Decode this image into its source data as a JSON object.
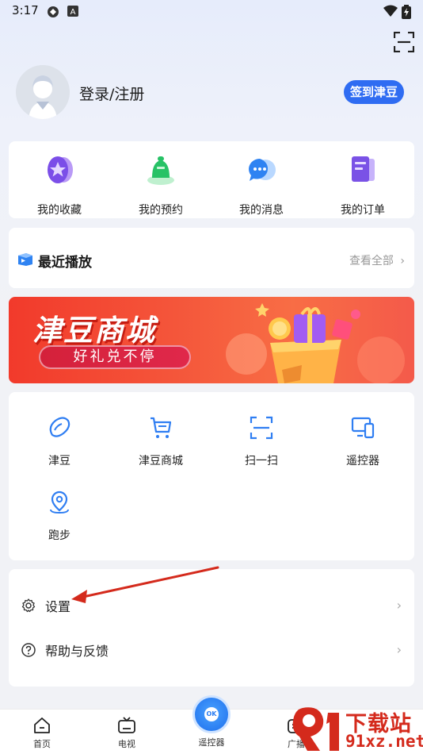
{
  "status_bar": {
    "time": "3:17"
  },
  "profile": {
    "login_label": "登录/注册",
    "checkin_label": "签到津豆"
  },
  "quick_links": [
    {
      "label": "我的收藏",
      "icon": "favorites-icon"
    },
    {
      "label": "我的预约",
      "icon": "reservation-bell-icon"
    },
    {
      "label": "我的消息",
      "icon": "message-bubble-icon"
    },
    {
      "label": "我的订单",
      "icon": "order-icon"
    }
  ],
  "recent": {
    "title": "最近播放",
    "more": "查看全部"
  },
  "banner": {
    "title": "津豆商城",
    "slogan": "好礼兑不停"
  },
  "tools": [
    {
      "label": "津豆",
      "icon": "bean-icon"
    },
    {
      "label": "津豆商城",
      "icon": "cart-icon"
    },
    {
      "label": "扫一扫",
      "icon": "scan-icon"
    },
    {
      "label": "遥控器",
      "icon": "devices-icon"
    },
    {
      "label": "跑步",
      "icon": "location-pin-icon"
    }
  ],
  "settings": [
    {
      "label": "设置",
      "icon": "gear-icon"
    },
    {
      "label": "帮助与反馈",
      "icon": "help-icon"
    }
  ],
  "bottom_nav": [
    {
      "label": "首页",
      "icon": "home-icon"
    },
    {
      "label": "电视",
      "icon": "tv-icon"
    },
    {
      "label": "遥控器",
      "icon": "remote-icon"
    },
    {
      "label": "广播",
      "icon": "radio-icon"
    }
  ],
  "remote_button": "OK",
  "watermark": {
    "title": "下载站",
    "site": "91xz.net"
  },
  "colors": {
    "accent": "#2f6cf2",
    "banner": "#f4553a",
    "annotation": "#d42a1c"
  }
}
